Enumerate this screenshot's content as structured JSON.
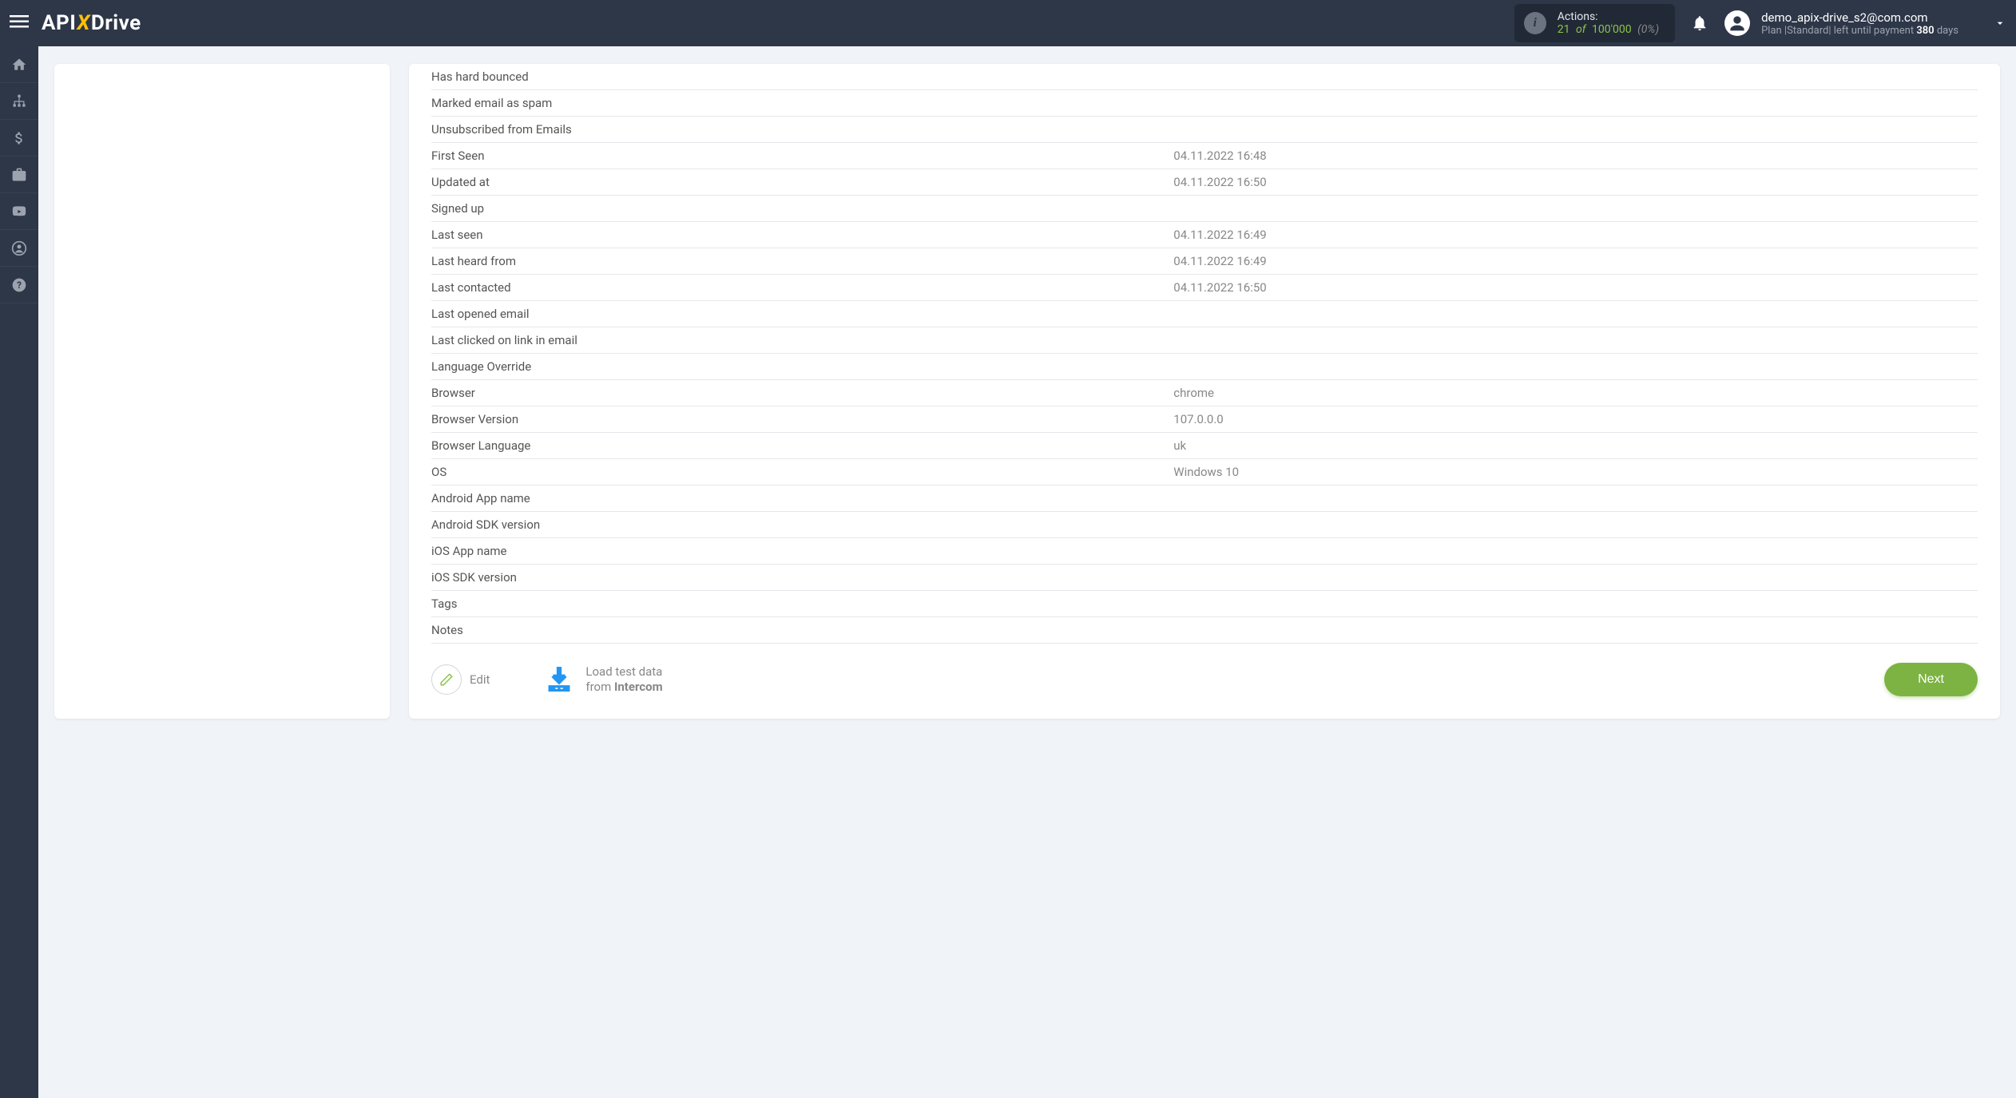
{
  "header": {
    "logo_pre": "API",
    "logo_x": "X",
    "logo_post": "Drive",
    "actions_label": "Actions:",
    "actions_used": "21",
    "actions_of": "of",
    "actions_total": "100'000",
    "actions_pct": "(0%)",
    "user_email": "demo_apix-drive_s2@com.com",
    "plan_prefix": "Plan |Standard| left until payment ",
    "plan_days": "380 ",
    "plan_days_suffix": "days"
  },
  "rows": [
    {
      "label": "Has hard bounced",
      "value": ""
    },
    {
      "label": "Marked email as spam",
      "value": ""
    },
    {
      "label": "Unsubscribed from Emails",
      "value": ""
    },
    {
      "label": "First Seen",
      "value": "04.11.2022 16:48"
    },
    {
      "label": "Updated at",
      "value": "04.11.2022 16:50"
    },
    {
      "label": "Signed up",
      "value": ""
    },
    {
      "label": "Last seen",
      "value": "04.11.2022 16:49"
    },
    {
      "label": "Last heard from",
      "value": "04.11.2022 16:49"
    },
    {
      "label": "Last contacted",
      "value": "04.11.2022 16:50"
    },
    {
      "label": "Last opened email",
      "value": ""
    },
    {
      "label": "Last clicked on link in email",
      "value": ""
    },
    {
      "label": "Language Override",
      "value": ""
    },
    {
      "label": "Browser",
      "value": "chrome"
    },
    {
      "label": "Browser Version",
      "value": "107.0.0.0"
    },
    {
      "label": "Browser Language",
      "value": "uk"
    },
    {
      "label": "OS",
      "value": "Windows 10"
    },
    {
      "label": "Android App name",
      "value": ""
    },
    {
      "label": "Android SDK version",
      "value": ""
    },
    {
      "label": "iOS App name",
      "value": ""
    },
    {
      "label": "iOS SDK version",
      "value": ""
    },
    {
      "label": "Tags",
      "value": ""
    },
    {
      "label": "Notes",
      "value": ""
    }
  ],
  "footer": {
    "edit": "Edit",
    "load_line1": "Load test data",
    "load_line2_pre": "from ",
    "load_brand": "Intercom",
    "next": "Next"
  }
}
